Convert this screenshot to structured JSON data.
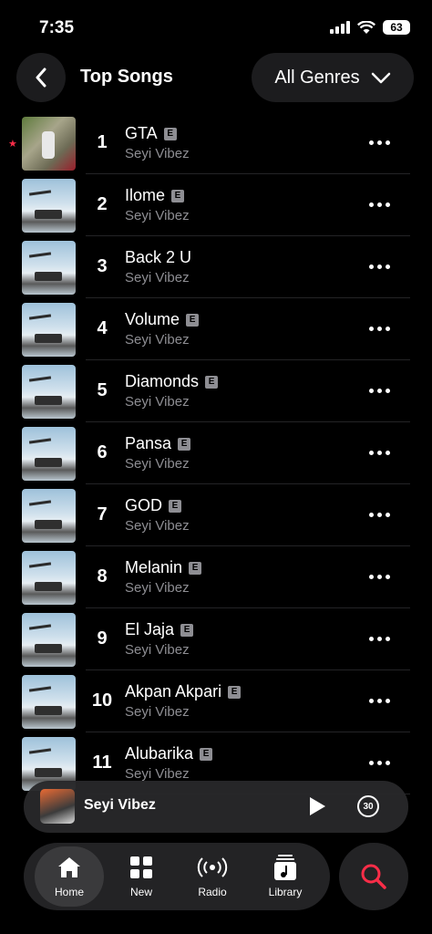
{
  "status": {
    "time": "7:35",
    "battery": "63"
  },
  "header": {
    "title": "Top Songs",
    "genre_label": "All Genres"
  },
  "colors": {
    "accent": "#fa2d48",
    "background": "#000000",
    "secondary_text": "#8e8e93"
  },
  "songs": [
    {
      "rank": "1",
      "title": "GTA",
      "artist": "Seyi Vibez",
      "explicit": "E"
    },
    {
      "rank": "2",
      "title": "Ilome",
      "artist": "Seyi Vibez",
      "explicit": "E"
    },
    {
      "rank": "3",
      "title": "Back 2 U",
      "artist": "Seyi Vibez",
      "explicit": ""
    },
    {
      "rank": "4",
      "title": "Volume",
      "artist": "Seyi Vibez",
      "explicit": "E"
    },
    {
      "rank": "5",
      "title": "Diamonds",
      "artist": "Seyi Vibez",
      "explicit": "E"
    },
    {
      "rank": "6",
      "title": "Pansa",
      "artist": "Seyi Vibez",
      "explicit": "E"
    },
    {
      "rank": "7",
      "title": "GOD",
      "artist": "Seyi Vibez",
      "explicit": "E"
    },
    {
      "rank": "8",
      "title": "Melanin",
      "artist": "Seyi Vibez",
      "explicit": "E"
    },
    {
      "rank": "9",
      "title": "El Jaja",
      "artist": "Seyi Vibez",
      "explicit": "E"
    },
    {
      "rank": "10",
      "title": "Akpan Akpari",
      "artist": "Seyi Vibez",
      "explicit": "E"
    },
    {
      "rank": "11",
      "title": "Alubarika",
      "artist": "Seyi Vibez",
      "explicit": "E"
    }
  ],
  "mini_player": {
    "title": "Seyi Vibez",
    "skip_label": "30"
  },
  "tabs": [
    {
      "label": "Home",
      "icon": "home-icon"
    },
    {
      "label": "New",
      "icon": "grid-icon"
    },
    {
      "label": "Radio",
      "icon": "radio-icon"
    },
    {
      "label": "Library",
      "icon": "library-icon"
    }
  ],
  "search_icon": "search-icon"
}
